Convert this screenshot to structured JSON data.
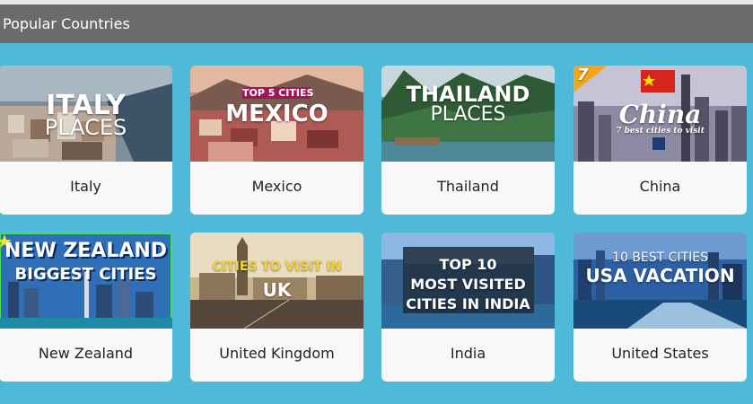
{
  "header": {
    "title": "Popular Countries"
  },
  "colors": {
    "background": "#4fbad8",
    "header": "#6b6b6b",
    "card": "#f8f8f8"
  },
  "cards": [
    {
      "name": "Italy",
      "overlay": [
        "ITALY",
        "PLACES"
      ]
    },
    {
      "name": "Mexico",
      "overlay": [
        "TOP 5 CITIES",
        "MEXICO"
      ]
    },
    {
      "name": "Thailand",
      "overlay": [
        "THAILAND",
        "PLACES"
      ]
    },
    {
      "name": "China",
      "overlay": [
        "China",
        "7 best cities to visit",
        "7"
      ]
    },
    {
      "name": "New Zealand",
      "overlay": [
        "NEW ZEALAND",
        "BIGGEST CITIES"
      ]
    },
    {
      "name": "United Kingdom",
      "overlay": [
        "CITIES TO VISIT IN",
        "UK"
      ]
    },
    {
      "name": "India",
      "overlay": [
        "TOP 10",
        "MOST VISITED",
        "CITIES IN INDIA"
      ]
    },
    {
      "name": "United States",
      "overlay": [
        "10 BEST CITIES",
        "USA VACATION"
      ]
    }
  ]
}
